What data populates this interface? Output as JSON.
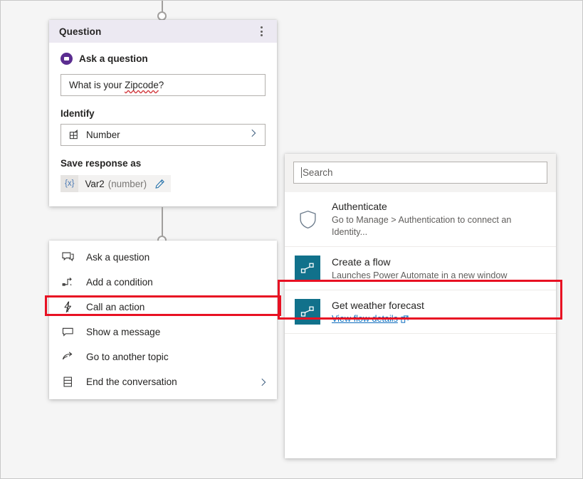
{
  "canvas": {
    "background_color": "#f5f5f5",
    "highlight_color": "#e81123"
  },
  "question_card": {
    "header": {
      "title": "Question",
      "menu_icon": "kebab-menu-icon",
      "background_color": "#ece9f2"
    },
    "ask_section": {
      "icon": "ask-question-icon",
      "label": "Ask a question",
      "accent_color": "#5b2d90"
    },
    "question_input": {
      "value": "What is your Zipcode?",
      "misspelled_word": "Zipcode"
    },
    "identify": {
      "label": "Identify",
      "icon": "entity-grid-icon",
      "selected": "Number",
      "chevron_icon": "chevron-right-icon"
    },
    "save_response": {
      "label": "Save response as",
      "variable_token": "{x}",
      "variable_name": "Var2",
      "variable_type": "(number)",
      "edit_icon": "pencil-edit-icon"
    }
  },
  "node_menu": {
    "items": [
      {
        "icon": "ask-question-chat-icon",
        "label": "Ask a question",
        "has_chevron": false,
        "highlighted": false
      },
      {
        "icon": "condition-branch-icon",
        "label": "Add a condition",
        "has_chevron": false,
        "highlighted": false
      },
      {
        "icon": "lightning-bolt-icon",
        "label": "Call an action",
        "has_chevron": false,
        "highlighted": true
      },
      {
        "icon": "message-bubble-icon",
        "label": "Show a message",
        "has_chevron": false,
        "highlighted": false
      },
      {
        "icon": "go-to-topic-arrow-icon",
        "label": "Go to another topic",
        "has_chevron": false,
        "highlighted": false
      },
      {
        "icon": "end-conversation-icon",
        "label": "End the conversation",
        "has_chevron": true,
        "highlighted": false
      }
    ]
  },
  "action_panel": {
    "search": {
      "placeholder": "Search",
      "value": ""
    },
    "actions": [
      {
        "icon": "shield-authenticate-icon",
        "icon_style": "outline",
        "title": "Authenticate",
        "subtitle": "Go to Manage > Authentication to connect an Identity...",
        "link": null,
        "highlighted": false
      },
      {
        "icon": "power-automate-flow-icon",
        "icon_style": "tile",
        "title": "Create a flow",
        "subtitle": "Launches Power Automate in a new window",
        "link": null,
        "highlighted": false
      },
      {
        "icon": "power-automate-flow-icon",
        "icon_style": "tile",
        "title": "Get weather forecast",
        "subtitle": null,
        "link": "View flow details",
        "link_icon": "external-link-icon",
        "highlighted": true
      }
    ]
  }
}
